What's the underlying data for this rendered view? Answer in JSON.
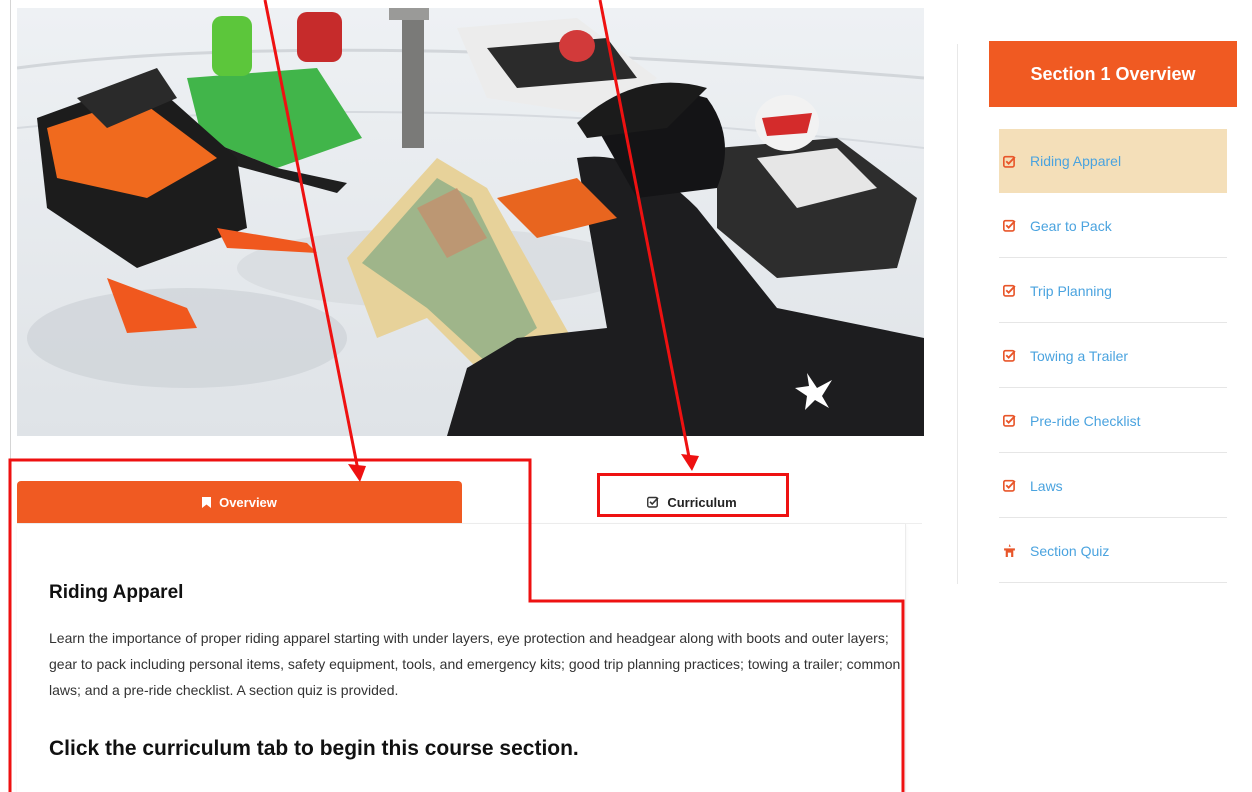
{
  "hero": {
    "image": "snowmobile-riders-reading-trail-map-photo"
  },
  "tabs": {
    "overview_label": "Overview",
    "curriculum_label": "Curriculum"
  },
  "content": {
    "title": "Riding Apparel",
    "body": "Learn the importance of proper riding apparel starting with under layers, eye protection and headgear along with boots and outer layers; gear to pack including personal items, safety equipment, tools, and emergency kits; good trip planning practices; towing a trailer; common laws; and a pre-ride checklist. A section quiz is provided.",
    "cta": "Click the curriculum tab to begin this course section."
  },
  "sidebar": {
    "header": "Section 1 Overview",
    "items": [
      {
        "label": "Riding Apparel",
        "icon": "checkbox-icon",
        "active": true
      },
      {
        "label": "Gear to Pack",
        "icon": "checkbox-icon"
      },
      {
        "label": "Trip Planning",
        "icon": "checkbox-icon"
      },
      {
        "label": "Towing a Trailer",
        "icon": "checkbox-icon"
      },
      {
        "label": "Pre-ride Checklist",
        "icon": "checkbox-icon"
      },
      {
        "label": "Laws",
        "icon": "checkbox-icon"
      },
      {
        "label": "Section Quiz",
        "icon": "quiz-icon"
      }
    ]
  },
  "colors": {
    "accent": "#f05a22",
    "active_item": "#f4dfb9",
    "link": "#4aa3df",
    "annotation": "#ee1111"
  }
}
